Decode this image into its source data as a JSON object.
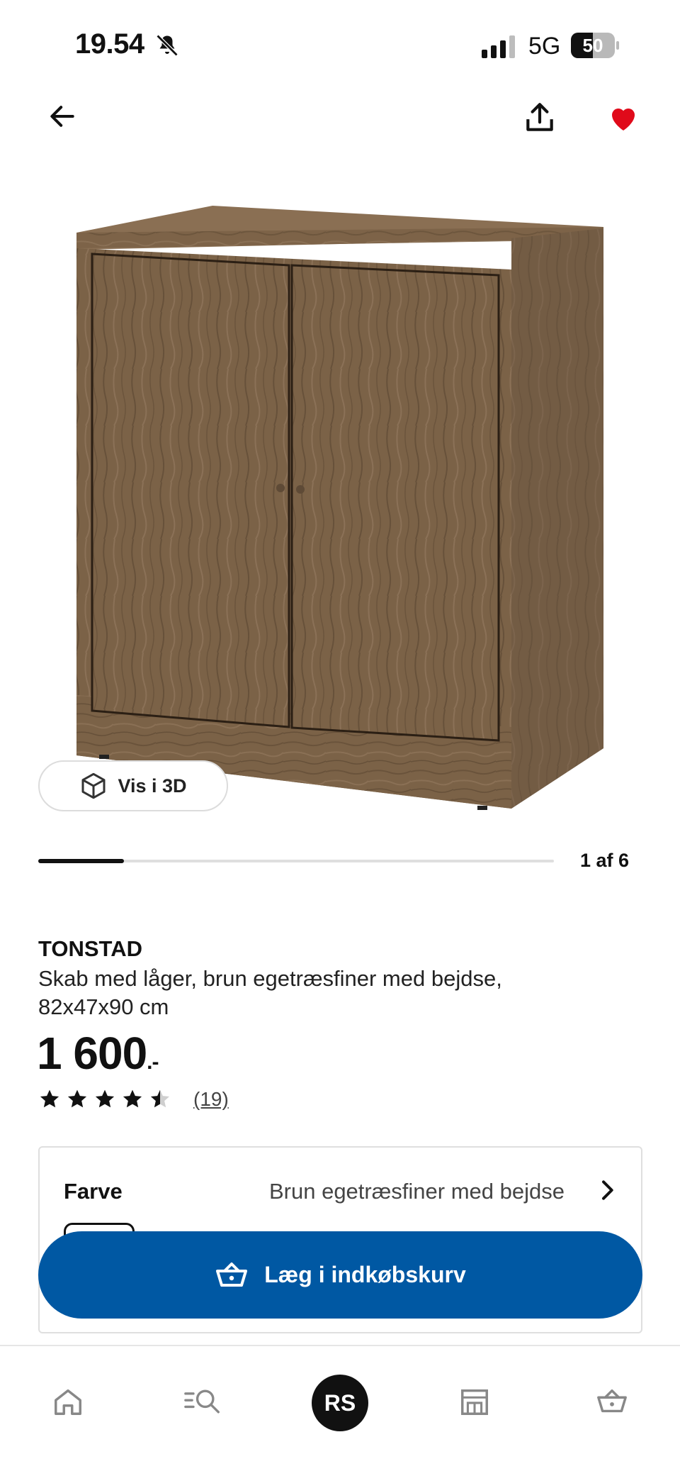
{
  "status_bar": {
    "time": "19.54",
    "network": "5G",
    "battery_percent": "50",
    "battery_level": 0.5
  },
  "header": {
    "back_icon": "arrow-left-icon",
    "share_icon": "share-icon",
    "favorite_icon": "heart-filled-icon",
    "favorite_color": "#e00a1a"
  },
  "gallery": {
    "view_3d_label": "Vis i 3D",
    "position_label": "1 af 6",
    "current": 1,
    "total": 6
  },
  "product": {
    "name": "TONSTAD",
    "description": "Skab med låger, brun egetræsfiner med bejdse, 82x47x90 cm",
    "price": "1 600",
    "price_suffix": ".-",
    "rating": 4.5,
    "reviews": "(19)"
  },
  "option": {
    "label": "Farve",
    "value": "Brun egetræsfiner med bejdse"
  },
  "cart": {
    "label": "Læg i indkøbskurv",
    "color": "#0058a3"
  },
  "bottom_nav": {
    "avatar_initials": "RS",
    "items": [
      "home-icon",
      "search-icon",
      "avatar",
      "store-icon",
      "basket-icon"
    ]
  }
}
